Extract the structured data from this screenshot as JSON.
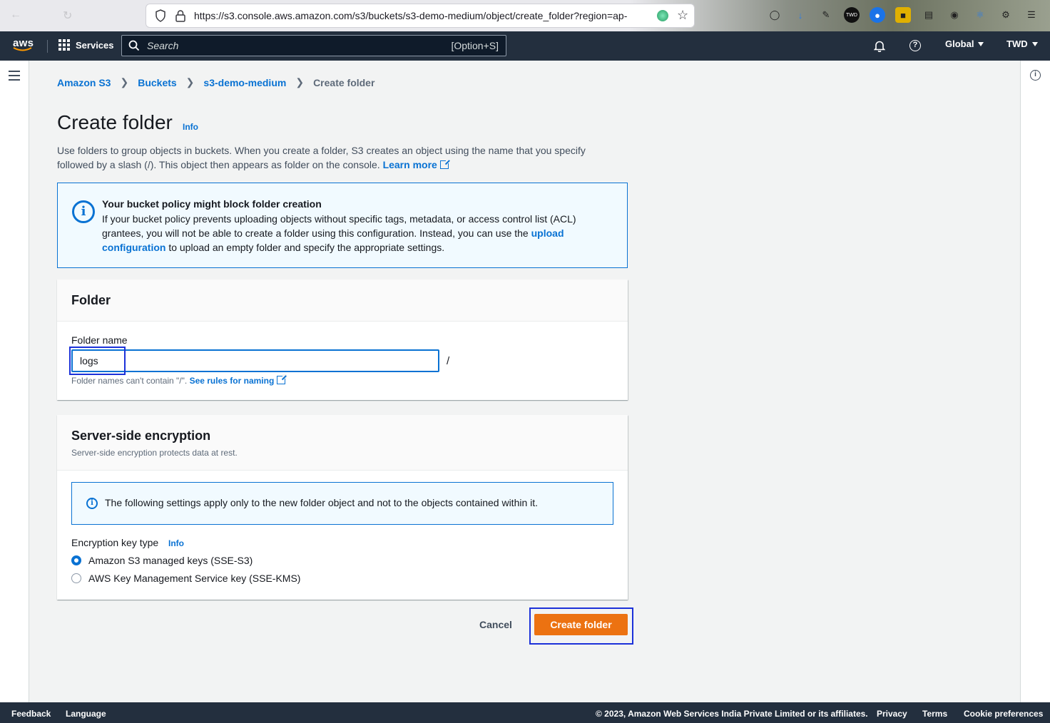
{
  "browser": {
    "url": "https://s3.console.aws.amazon.com/s3/buckets/s3-demo-medium/object/create_folder?region=ap-"
  },
  "header": {
    "logo": "aws",
    "services_label": "Services",
    "search_placeholder": "Search",
    "search_shortcut": "[Option+S]",
    "region": "Global",
    "account": "TWD"
  },
  "breadcrumb": {
    "items": [
      "Amazon S3",
      "Buckets",
      "s3-demo-medium"
    ],
    "current": "Create folder"
  },
  "page": {
    "title": "Create folder",
    "info": "Info",
    "description": "Use folders to group objects in buckets. When you create a folder, S3 creates an object using the name that you specify followed by a slash (/). This object then appears as folder on the console.",
    "learn_more": "Learn more"
  },
  "alert": {
    "title": "Your bucket policy might block folder creation",
    "body_before": "If your bucket policy prevents uploading objects without specific tags, metadata, or access control list (ACL) grantees, you will not be able to create a folder using this configuration. Instead, you can use the ",
    "link": "upload configuration",
    "body_after": " to upload an empty folder and specify the appropriate settings."
  },
  "folder": {
    "heading": "Folder",
    "name_label": "Folder name",
    "name_value": "logs",
    "slash": "/",
    "constraint": "Folder names can't contain \"/\".",
    "rules_link": "See rules for naming"
  },
  "encryption": {
    "heading": "Server-side encryption",
    "description": "Server-side encryption protects data at rest.",
    "note": "The following settings apply only to the new folder object and not to the objects contained within it.",
    "key_type_label": "Encryption key type",
    "info": "Info",
    "options": [
      "Amazon S3 managed keys (SSE-S3)",
      "AWS Key Management Service key (SSE-KMS)"
    ],
    "selected_index": 0
  },
  "actions": {
    "cancel": "Cancel",
    "create": "Create folder"
  },
  "footer": {
    "feedback": "Feedback",
    "language": "Language",
    "copyright": "© 2023, Amazon Web Services India Private Limited or its affiliates.",
    "privacy": "Privacy",
    "terms": "Terms",
    "cookies": "Cookie preferences"
  },
  "colors": {
    "link": "#0972d3",
    "primary_button": "#ec7211",
    "header_bg": "#232f3e",
    "focus": "#1c31d9"
  }
}
